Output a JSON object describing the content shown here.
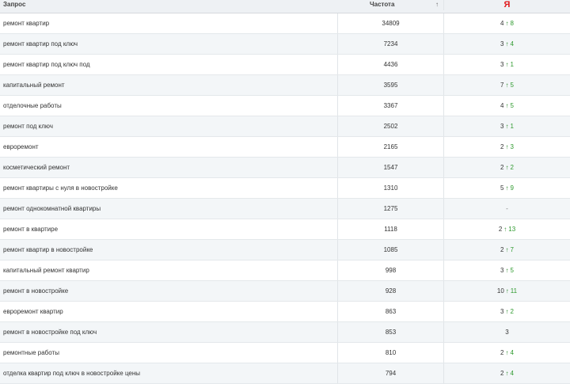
{
  "header": {
    "query_label": "Запрос",
    "frequency_label": "Частота",
    "sort_glyph": "↑",
    "yandex_label": "Я"
  },
  "colors": {
    "accent_red": "#e0181b",
    "up_green": "#2e9a2e",
    "row_alt": "#f3f6f8"
  },
  "rows": [
    {
      "query": "ремонт квартир",
      "freq": "34809",
      "pos": "4",
      "arrow": "↑",
      "delta": "8"
    },
    {
      "query": "ремонт квартир под ключ",
      "freq": "7234",
      "pos": "3",
      "arrow": "↑",
      "delta": "4"
    },
    {
      "query": "ремонт квартир под ключ под",
      "freq": "4436",
      "pos": "3",
      "arrow": "↑",
      "delta": "1"
    },
    {
      "query": "капитальный ремонт",
      "freq": "3595",
      "pos": "7",
      "arrow": "↑",
      "delta": "5"
    },
    {
      "query": "отделочные работы",
      "freq": "3367",
      "pos": "4",
      "arrow": "↑",
      "delta": "5"
    },
    {
      "query": "ремонт под ключ",
      "freq": "2502",
      "pos": "3",
      "arrow": "↑",
      "delta": "1"
    },
    {
      "query": "евроремонт",
      "freq": "2165",
      "pos": "2",
      "arrow": "↑",
      "delta": "3"
    },
    {
      "query": "косметический ремонт",
      "freq": "1547",
      "pos": "2",
      "arrow": "↑",
      "delta": "2"
    },
    {
      "query": "ремонт квартиры с нуля в новостройке",
      "freq": "1310",
      "pos": "5",
      "arrow": "↑",
      "delta": "9"
    },
    {
      "query": "ремонт однокомнатной квартиры",
      "freq": "1275",
      "pos": "-",
      "arrow": "",
      "delta": ""
    },
    {
      "query": "ремонт в квартире",
      "freq": "1118",
      "pos": "2",
      "arrow": "↑",
      "delta": "13"
    },
    {
      "query": "ремонт квартир в новостройке",
      "freq": "1085",
      "pos": "2",
      "arrow": "↑",
      "delta": "7"
    },
    {
      "query": "капитальный ремонт квартир",
      "freq": "998",
      "pos": "3",
      "arrow": "↑",
      "delta": "5"
    },
    {
      "query": "ремонт в новостройке",
      "freq": "928",
      "pos": "10",
      "arrow": "↑",
      "delta": "11"
    },
    {
      "query": "евроремонт квартир",
      "freq": "863",
      "pos": "3",
      "arrow": "↑",
      "delta": "2"
    },
    {
      "query": "ремонт в новостройке под ключ",
      "freq": "853",
      "pos": "3",
      "arrow": "",
      "delta": ""
    },
    {
      "query": "ремонтные работы",
      "freq": "810",
      "pos": "2",
      "arrow": "↑",
      "delta": "4"
    },
    {
      "query": "отделка квартир под ключ в новостройке цены",
      "freq": "794",
      "pos": "2",
      "arrow": "↑",
      "delta": "4"
    }
  ]
}
